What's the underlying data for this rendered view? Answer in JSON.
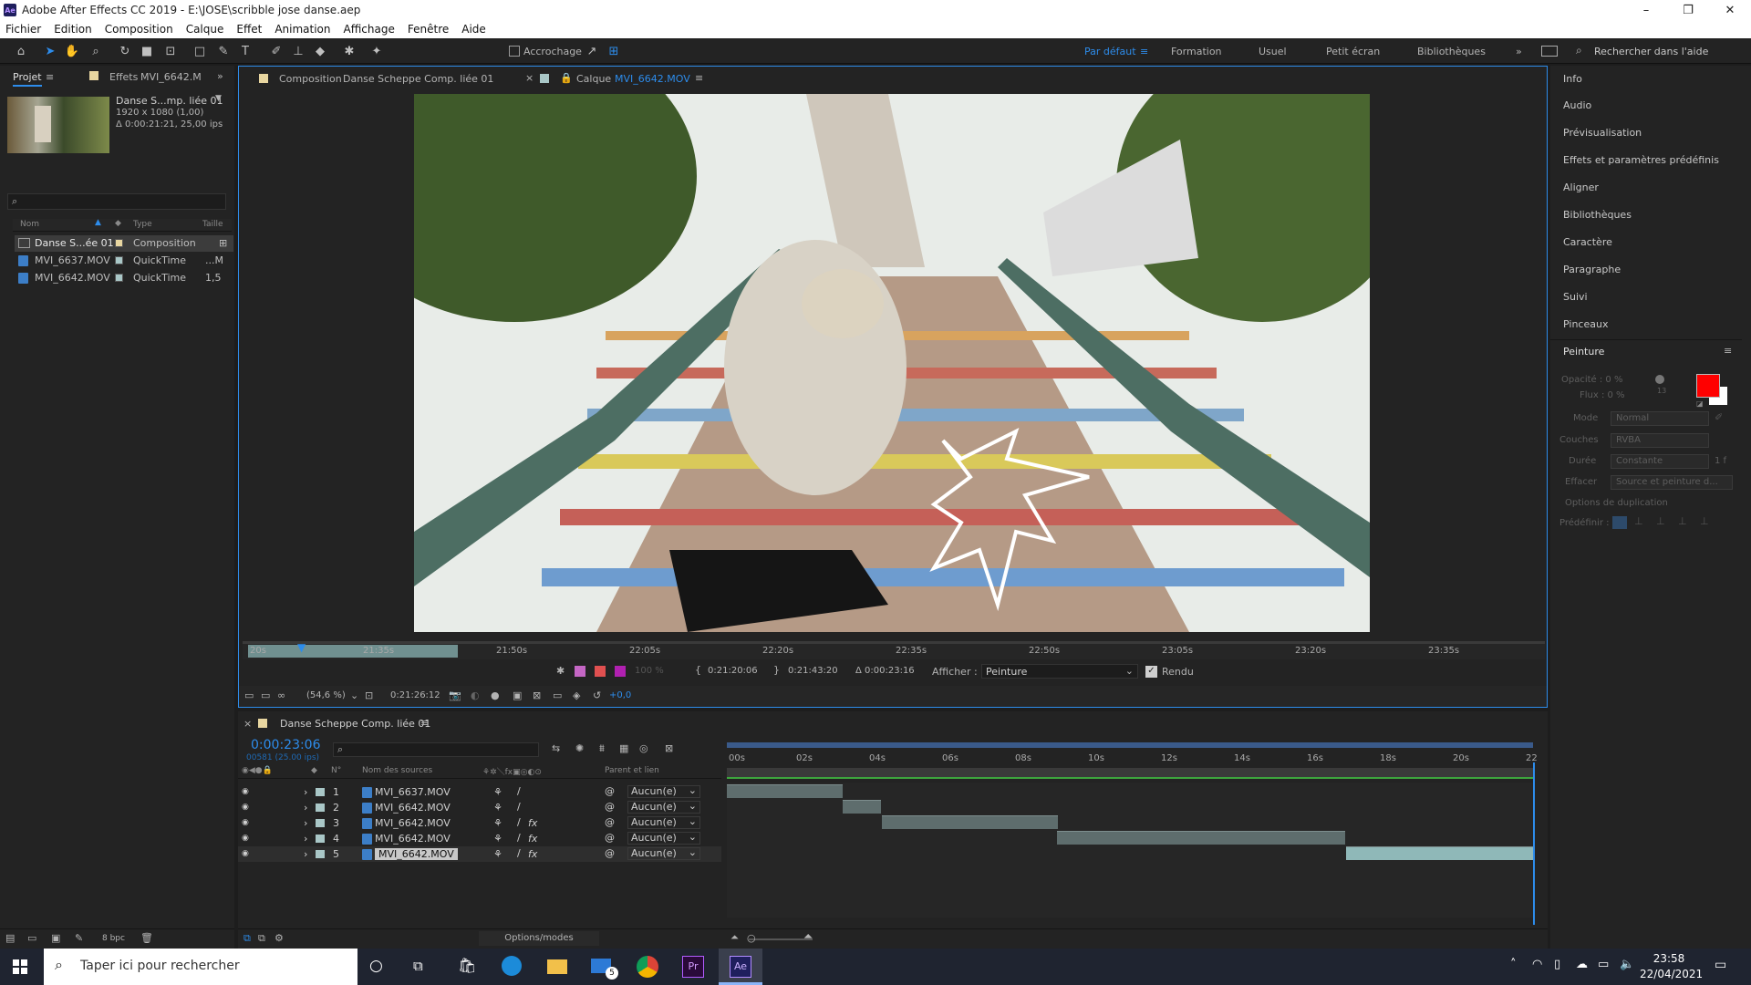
{
  "window": {
    "title": "Adobe After Effects CC 2019 - E:\\JOSE\\scribble jose danse.aep",
    "app_icon": "Ae",
    "minimize": "–",
    "maximize": "❐",
    "close": "✕"
  },
  "menu": [
    "Fichier",
    "Edition",
    "Composition",
    "Calque",
    "Effet",
    "Animation",
    "Affichage",
    "Fenêtre",
    "Aide"
  ],
  "toolbar": {
    "snap_label": "Accrochage",
    "workspaces": [
      "Par défaut",
      "Formation",
      "Usuel",
      "Petit écran",
      "Bibliothèques"
    ],
    "active_workspace": "Par défaut",
    "search_help": "Rechercher dans l'aide"
  },
  "project_panel": {
    "tab_project": "Projet",
    "tab_effects": "Effets",
    "tab_effects_target": "MVI_6642.M",
    "comp_name": "Danse S...mp. liée 01",
    "comp_res": "1920 x 1080 (1,00)",
    "comp_duration": "Δ 0:00:21:21, 25,00 ips",
    "search_icon": "search-icon",
    "col_name": "Nom",
    "col_type": "Type",
    "col_size": "Taille",
    "items": [
      {
        "name": "Danse S...ée 01",
        "type": "Composition",
        "size": "",
        "swatch": "#e8d6a0",
        "kind": "comp"
      },
      {
        "name": "MVI_6637.MOV",
        "type": "QuickTime",
        "size": "...M",
        "swatch": "#a9c7c7",
        "kind": "file"
      },
      {
        "name": "MVI_6642.MOV",
        "type": "QuickTime",
        "size": "1,5",
        "swatch": "#a9c7c7",
        "kind": "file"
      }
    ],
    "bpc": "8 bpc"
  },
  "viewer": {
    "tab_comp_prefix": "Composition",
    "tab_comp_name": "Danse Scheppe Comp. liée 01",
    "tab_layer_prefix": "Calque",
    "tab_layer_name": "MVI_6642.MOV",
    "ruler_ticks": [
      "20s",
      "21:35s",
      "21:50s",
      "22:05s",
      "22:20s",
      "22:35s",
      "22:50s",
      "23:05s",
      "23:20s",
      "23:35s"
    ],
    "opacity": "100 %",
    "in_time": "0:21:20:06",
    "out_time": "0:21:43:20",
    "delta": "Δ 0:00:23:16",
    "afficher_label": "Afficher :",
    "afficher_value": "Peinture",
    "rendu_label": "Rendu",
    "zoom": "(54,6 %)",
    "current_time": "0:21:26:12",
    "exposure": "+0,0"
  },
  "right_panel": {
    "items": [
      "Info",
      "Audio",
      "Prévisualisation",
      "Effets et paramètres prédéfinis",
      "Aligner",
      "Bibliothèques",
      "Caractère",
      "Paragraphe",
      "Suivi",
      "Pinceaux"
    ],
    "paint_title": "Peinture",
    "opacity_label": "Opacité : 0 %",
    "flux_label": "Flux : 0 %",
    "brush_size": "13",
    "mode_label": "Mode",
    "mode_value": "Normal",
    "channels_label": "Couches",
    "channels_value": "RVBA",
    "duration_label": "Durée",
    "duration_value": "Constante",
    "duration_frames": "1 f",
    "erase_label": "Effacer",
    "erase_value": "Source et peinture d...",
    "dup_options": "Options de duplication",
    "preset_label": "Prédéfinir :",
    "fg_color": "#ff0000",
    "bg_color": "#ffffff"
  },
  "timeline": {
    "tab_name": "Danse Scheppe Comp. liée 01",
    "time": "0:00:23:06",
    "frames": "00581 (25.00 ips)",
    "col_num": "N°",
    "col_source": "Nom des sources",
    "col_parent": "Parent et lien",
    "ticks": [
      "00s",
      "02s",
      "04s",
      "06s",
      "08s",
      "10s",
      "12s",
      "14s",
      "16s",
      "18s",
      "20s",
      "22"
    ],
    "layers": [
      {
        "num": "1",
        "name": "MVI_6637.MOV",
        "parent": "Aucun(e)",
        "fx": false,
        "start": 0.0,
        "end": 0.144
      },
      {
        "num": "2",
        "name": "MVI_6642.MOV",
        "parent": "Aucun(e)",
        "fx": false,
        "start": 0.144,
        "end": 0.192
      },
      {
        "num": "3",
        "name": "MVI_6642.MOV",
        "parent": "Aucun(e)",
        "fx": true,
        "start": 0.192,
        "end": 0.41
      },
      {
        "num": "4",
        "name": "MVI_6642.MOV",
        "parent": "Aucun(e)",
        "fx": true,
        "start": 0.41,
        "end": 0.768
      },
      {
        "num": "5",
        "name": "MVI_6642.MOV",
        "parent": "Aucun(e)",
        "fx": true,
        "start": 0.768,
        "end": 1.0
      }
    ],
    "options_modes": "Options/modes"
  },
  "taskbar": {
    "search_placeholder": "Taper ici pour rechercher",
    "time": "23:58",
    "date": "22/04/2021",
    "mail_badge": "5",
    "premiere": "Pr",
    "aftereffects": "Ae"
  }
}
